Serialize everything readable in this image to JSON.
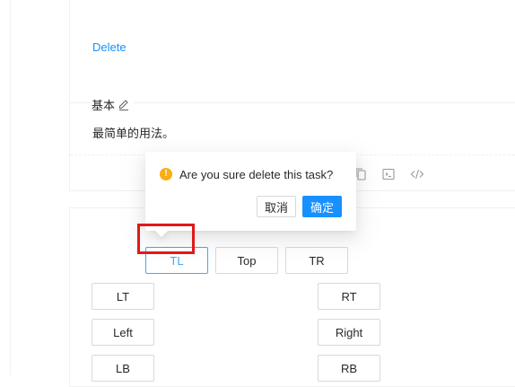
{
  "demo1": {
    "delete_label": "Delete",
    "meta_title": "基本",
    "meta_description": "最简单的用法。",
    "icons": [
      "copy-icon",
      "codesandbox-icon",
      "code-expand-icon"
    ]
  },
  "popconfirm": {
    "title": "Are you sure delete this task?",
    "cancel_label": "取消",
    "ok_label": "确定",
    "icon": "exclamation-circle-icon"
  },
  "placement": {
    "top_row": [
      "TL",
      "Top",
      "TR"
    ],
    "left_col": [
      "LT",
      "Left",
      "LB"
    ],
    "right_col": [
      "RT",
      "Right",
      "RB"
    ],
    "active": "TL"
  },
  "colors": {
    "primary": "#1890ff",
    "warning": "#faad14",
    "highlight": "#e0191a",
    "border": "#d9d9d9"
  }
}
